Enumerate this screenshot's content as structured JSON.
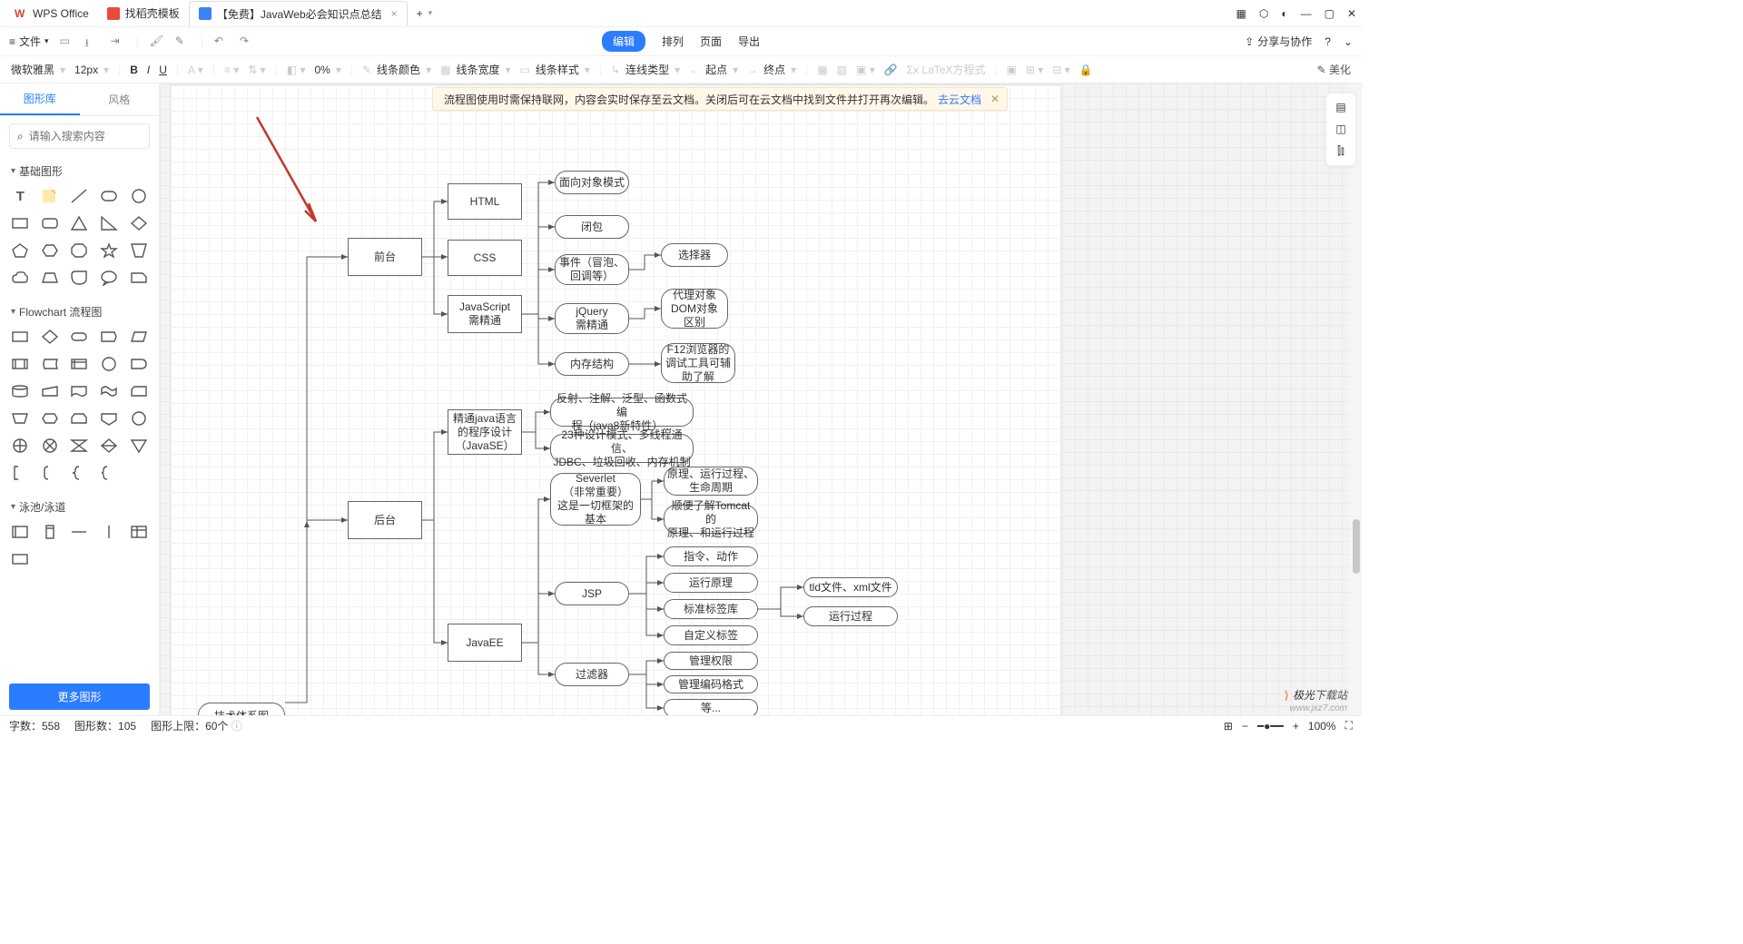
{
  "tabs": {
    "t0": "WPS Office",
    "t1": "找稻壳模板",
    "t2": "【免费】JavaWeb必会知识点总结",
    "plus": "+"
  },
  "menu": {
    "file": "文件",
    "edit": "编辑",
    "arrange": "排列",
    "page": "页面",
    "export": "导出",
    "share": "分享与协作"
  },
  "fmt": {
    "font": "微软雅黑",
    "size": "12px",
    "pct": "0%",
    "lineColor": "线条颜色",
    "lineWidth": "线条宽度",
    "lineStyle": "线条样式",
    "connType": "连线类型",
    "start": "起点",
    "end": "终点",
    "latex": "Σx LaTeX方程式",
    "beautify": "✎ 美化"
  },
  "side": {
    "tabA": "图形库",
    "tabB": "风格",
    "searchPh": "请输入搜索内容",
    "cat1": "基础图形",
    "cat2": "Flowchart 流程图",
    "cat3": "泳池/泳道",
    "more": "更多图形"
  },
  "banner": {
    "text": "流程图使用时需保持联网，内容会实时保存至云文档。关闭后可在云文档中找到文件并打开再次编辑。",
    "link": "去云文档"
  },
  "nodes": {
    "front": "前台",
    "back": "后台",
    "html": "HTML",
    "css": "CSS",
    "js": "JavaScript\n需精通",
    "oop": "面向对象模式",
    "closure": "闭包",
    "event": "事件（冒泡、\n回调等）",
    "jquery": "jQuery\n需精通",
    "memory": "内存结构",
    "selector": "选择器",
    "proxy": "代理对象\nDOM对象\n区别",
    "f12": "F12浏览器的\n调试工具可辅\n助了解",
    "javase": "精通java语言\n的程序设计\n（JavaSE）",
    "reflect": "反射、注解、泛型、函数式编\n程（java8新特性）...",
    "design": "23种设计模式、多线程通信、\nJDBC、垃圾回收、内存机制",
    "servlet": "Severlet\n（非常重要）\n这是一切框架的\n基本",
    "life": "原理、运行过程、\n生命周期",
    "tomcat": "顺便了解Tomcat的\n原理、和运行过程",
    "javaee": "JavaEE",
    "jsp": "JSP",
    "cmd": "指令、动作",
    "yl": "运行原理",
    "tag": "标准标签库",
    "custom": "自定义标签",
    "tld": "tld文件、xml文件",
    "proc": "运行过程",
    "filter": "过滤器",
    "perm": "管理权限",
    "enc": "管理编码格式",
    "etc": "等...",
    "arch": "技术体系图"
  },
  "status": {
    "words": "字数：558",
    "shapes": "图形数：105",
    "limit": "图形上限：60个",
    "zoom": "100%"
  },
  "watermark": {
    "a": "极光",
    "b": "下载站"
  }
}
